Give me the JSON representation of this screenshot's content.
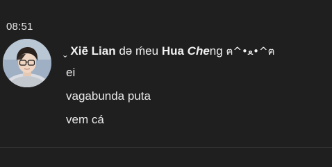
{
  "timestamp": "08:51",
  "sender": {
    "prefix": "ˬ ",
    "xie": "Xiē",
    "lian": "Lian",
    "de": "də",
    "meu": "ḿeu",
    "hua": "Hua",
    "cheng": "Che",
    "cheng_tail": "ng",
    "emoticon": "ฅ^•ﻌ•^ฅ"
  },
  "messages": [
    {
      "text": "ei"
    },
    {
      "text": "vagabunda puta"
    },
    {
      "text": "vem cá"
    }
  ],
  "icons": {
    "avatar": "user-avatar-photo"
  }
}
